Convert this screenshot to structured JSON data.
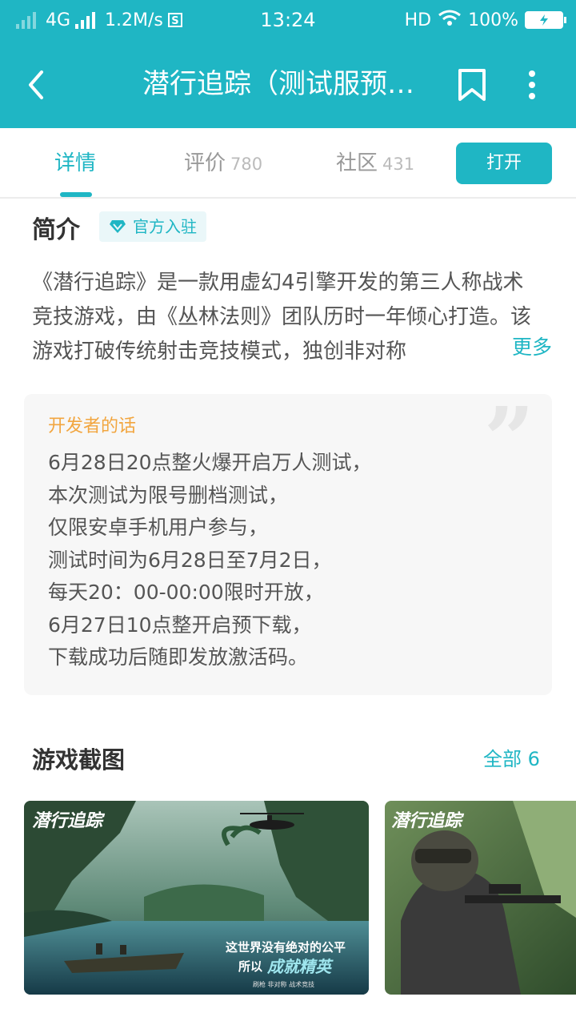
{
  "status_bar": {
    "network": "4G",
    "speed": "1.2M/s",
    "sim_badge": "S",
    "time": "13:24",
    "hd": "HD",
    "battery": "100%"
  },
  "app_bar": {
    "title": "潜行追踪（测试服预…"
  },
  "tabs": [
    {
      "label": "详情",
      "count": ""
    },
    {
      "label": "评价",
      "count": "780"
    },
    {
      "label": "社区",
      "count": "431"
    }
  ],
  "open_button": "打开",
  "intro": {
    "title": "简介",
    "badge": "官方入驻",
    "text": "《潜行追踪》是一款用虚幻4引擎开发的第三人称战术竞技游戏，由《丛林法则》团队历时一年倾心打造。该游戏打破传统射击竞技模式，独创非对称",
    "more": "更多"
  },
  "developer": {
    "title": "开发者的话",
    "lines": [
      "6月28日20点整火爆开启万人测试，",
      "本次测试为限号删档测试，",
      "仅限安卓手机用户参与，",
      "测试时间为6月28日至7月2日，",
      "每天20：00-00:00限时开放，",
      "6月27日10点整开启预下载，",
      "下载成功后随即发放激活码。"
    ]
  },
  "screenshots": {
    "title": "游戏截图",
    "all_label": "全部 6",
    "shot1": {
      "logo": "潜行追踪",
      "slogan1": "这世界没有绝对的公平",
      "slogan2a": "所以",
      "slogan2b": "成就精英",
      "slogan3": "刷枪 非对称 战术竞技"
    },
    "shot2": {
      "logo": "潜行追踪"
    }
  },
  "colors": {
    "accent": "#1fb6c4",
    "developer_title": "#f2a640"
  }
}
